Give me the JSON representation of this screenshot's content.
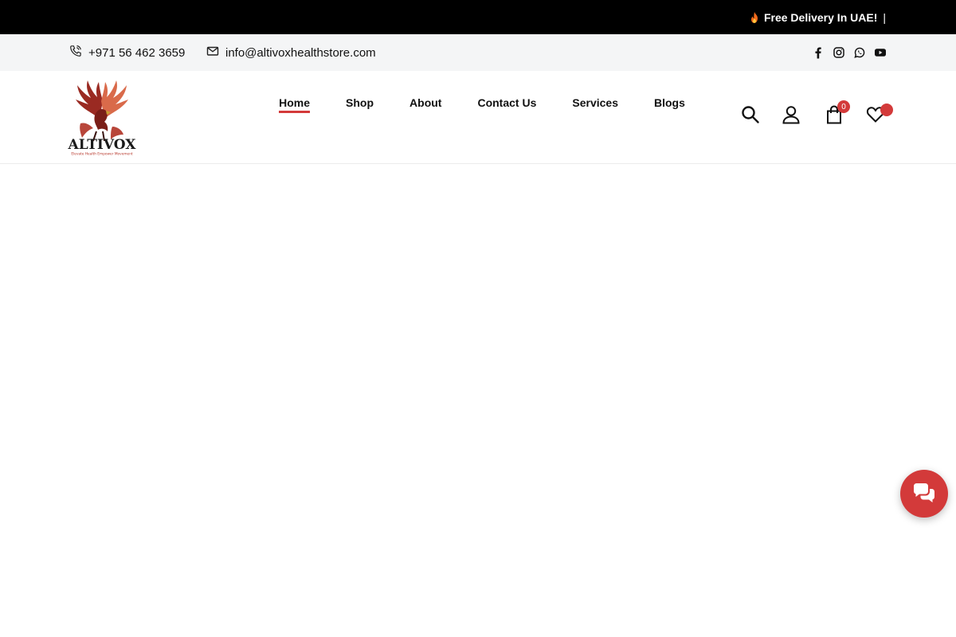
{
  "announcement": {
    "text": "Free Delivery In UAE!",
    "separator": "|",
    "icon": "fire-icon"
  },
  "topbar": {
    "phone": "+971 56 462 3659",
    "phone_icon": "phone-icon",
    "email": "info@altivoxhealthstore.com",
    "email_icon": "envelope-icon",
    "socials": [
      "facebook-icon",
      "instagram-icon",
      "whatsapp-icon",
      "youtube-icon"
    ]
  },
  "header": {
    "logo": {
      "brand": "ALTIVOX",
      "tagline": "Elevate Health Empower Movement"
    },
    "nav": [
      {
        "label": "Home",
        "active": true
      },
      {
        "label": "Shop",
        "active": false
      },
      {
        "label": "About",
        "active": false
      },
      {
        "label": "Contact Us",
        "active": false
      },
      {
        "label": "Services",
        "active": false
      },
      {
        "label": "Blogs",
        "active": false
      }
    ],
    "cart_count": "0",
    "wishlist_count": ""
  },
  "colors": {
    "accent": "#d33a3a",
    "announcement_bg": "#000000",
    "topbar_bg": "#f4f5f6",
    "text": "#111111"
  },
  "chat": {
    "icon": "chat-bubbles-icon"
  }
}
